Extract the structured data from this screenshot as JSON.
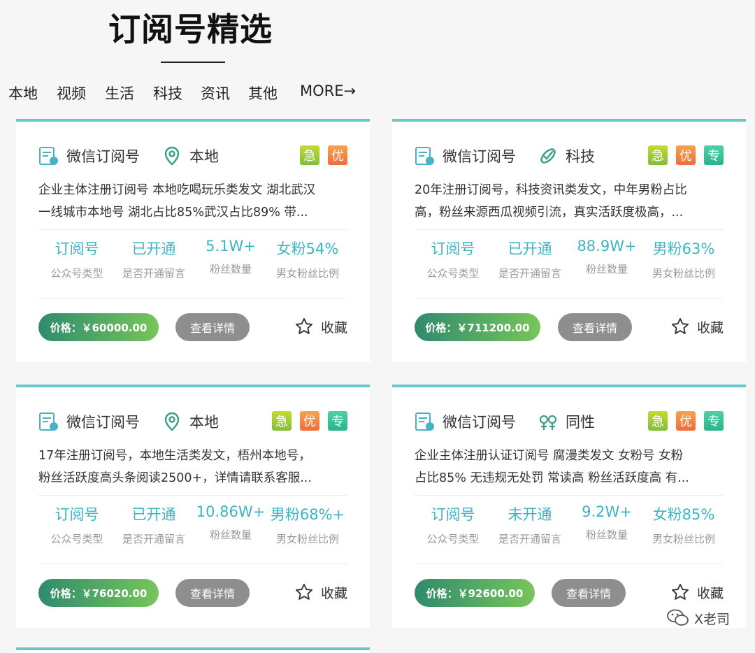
{
  "header": {
    "title": "订阅号精选"
  },
  "nav": [
    {
      "label": "本地",
      "icon": ""
    },
    {
      "label": "视频",
      "icon": ""
    },
    {
      "label": "生活",
      "icon": ""
    },
    {
      "label": "科技",
      "icon": ""
    },
    {
      "label": "资讯",
      "icon": ""
    },
    {
      "label": "其他",
      "icon": ""
    },
    {
      "label": "MORE→",
      "icon": ""
    }
  ],
  "cards": [
    {
      "platform": "微信订阅号",
      "category": "本地",
      "category_icon": "location-pin-icon",
      "badges": [
        "急",
        "优"
      ],
      "desc": [
        "企业主体注册订阅号 本地吃喝玩乐类发文 湖北武汉",
        "一线城市本地号 湖北占比85%武汉占比89% 带..."
      ],
      "stats": [
        {
          "value": "订阅号",
          "label": "公众号类型"
        },
        {
          "value": "已开通",
          "label": "是否开通留言"
        },
        {
          "value": "5.1W+",
          "label": "粉丝数量"
        },
        {
          "value": "女粉54%",
          "label": "男女粉丝比例"
        }
      ],
      "price": "价格：￥60000.00",
      "detail": "查看详情",
      "fav": "收藏"
    },
    {
      "platform": "微信订阅号",
      "category": "科技",
      "category_icon": "tech-icon",
      "badges": [
        "急",
        "优",
        "专"
      ],
      "desc": [
        "20年注册订阅号，科技资讯类发文，中年男粉占比",
        "高，粉丝来源西瓜视频引流，真实活跃度极高，..."
      ],
      "stats": [
        {
          "value": "订阅号",
          "label": "公众号类型"
        },
        {
          "value": "已开通",
          "label": "是否开通留言"
        },
        {
          "value": "88.9W+",
          "label": "粉丝数量"
        },
        {
          "value": "男粉63%",
          "label": "男女粉丝比例"
        }
      ],
      "price": "价格：￥711200.00",
      "detail": "查看详情",
      "fav": "收藏"
    },
    {
      "platform": "微信订阅号",
      "category": "本地",
      "category_icon": "location-pin-icon",
      "badges": [
        "急",
        "优",
        "专"
      ],
      "desc": [
        "17年注册订阅号，本地生活类发文，梧州本地号，",
        "粉丝活跃度高头条阅读2500+，详情请联系客服..."
      ],
      "stats": [
        {
          "value": "订阅号",
          "label": "公众号类型"
        },
        {
          "value": "已开通",
          "label": "是否开通留言"
        },
        {
          "value": "10.86W+",
          "label": "粉丝数量"
        },
        {
          "value": "男粉68%+",
          "label": "男女粉丝比例"
        }
      ],
      "price": "价格：￥76020.00",
      "detail": "查看详情",
      "fav": "收藏"
    },
    {
      "platform": "微信订阅号",
      "category": "同性",
      "category_icon": "gender-icon",
      "badges": [
        "急",
        "优",
        "专"
      ],
      "desc": [
        "企业主体注册认证订阅号 腐漫类发文 女粉号 女粉",
        "占比85% 无违规无处罚 常读高 粉丝活跃度高 有..."
      ],
      "stats": [
        {
          "value": "订阅号",
          "label": "公众号类型"
        },
        {
          "value": "未开通",
          "label": "是否开通留言"
        },
        {
          "value": "9.2W+",
          "label": "粉丝数量"
        },
        {
          "value": "女粉85%",
          "label": "男女粉丝比例"
        }
      ],
      "price": "价格：￥92600.00",
      "detail": "查看详情",
      "fav": "收藏"
    }
  ],
  "watermark": "X老司",
  "colors": {
    "accent": "#6cc5c9",
    "stat": "#3cb4c4",
    "price_start": "#2f8b6d",
    "price_end": "#77c55a"
  }
}
